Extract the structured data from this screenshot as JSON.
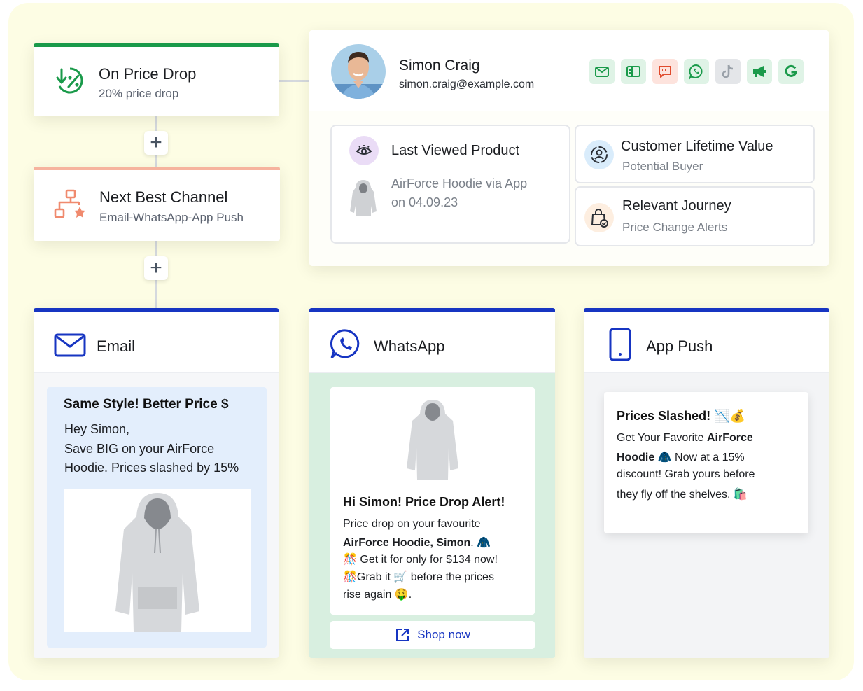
{
  "trigger": {
    "title": "On Price Drop",
    "subtitle": "20% price drop"
  },
  "next_best": {
    "title": "Next Best Channel",
    "subtitle": "Email-WhatsApp-App Push"
  },
  "plus_symbol": "+",
  "profile": {
    "name": "Simon Craig",
    "email": "simon.craig@example.com",
    "channel_icons": [
      "email-icon",
      "sms-card-icon",
      "chat-message-icon",
      "whatsapp-icon",
      "tiktok-icon",
      "megaphone-icon",
      "google-icon"
    ],
    "last_viewed": {
      "label": "Last Viewed Product",
      "line1": "AirForce Hoodie via App",
      "line2": "on 04.09.23"
    },
    "clv": {
      "label": "Customer Lifetime Value",
      "value": "Potential Buyer"
    },
    "journey": {
      "label": "Relevant Journey",
      "value": "Price Change Alerts"
    }
  },
  "email": {
    "channel": "Email",
    "subject": "Same Style! Better Price $",
    "greeting": "Hey Simon,",
    "body_line1": "Save BIG on your AirForce",
    "body_line2": "Hoodie. Prices slashed by 15%"
  },
  "whatsapp": {
    "channel": "WhatsApp",
    "headline": "Hi Simon! Price Drop Alert!",
    "line1": "Price drop on your favourite",
    "line2_bold": "AirForce Hoodie, Simon",
    "line2_end": ". 🧥",
    "line3": "🎊 Get it for only for $134 now!",
    "line4_a": "🎊Grab it ",
    "line4_cart": "🛒",
    "line4_b": " before the prices",
    "line5": "rise again 🤑.",
    "cta": "Shop now"
  },
  "app_push": {
    "channel": "App Push",
    "title": "Prices Slashed! 📉💰",
    "line1_a": "Get Your Favorite ",
    "line1_bold": "AirForce",
    "line2_bold": "Hoodie",
    "line2_rest": " 🧥 Now at a 15%",
    "line3": "discount! Grab yours before",
    "line4": "they fly off the shelves. 🛍️"
  },
  "colors": {
    "background": "#fdfde4",
    "trigger_accent": "#1a9a4a",
    "next_best_accent": "#f6b39e",
    "channel_accent": "#1735c2",
    "email_body_bg": "#e3eefc",
    "whatsapp_body_bg": "#d8efe0"
  }
}
